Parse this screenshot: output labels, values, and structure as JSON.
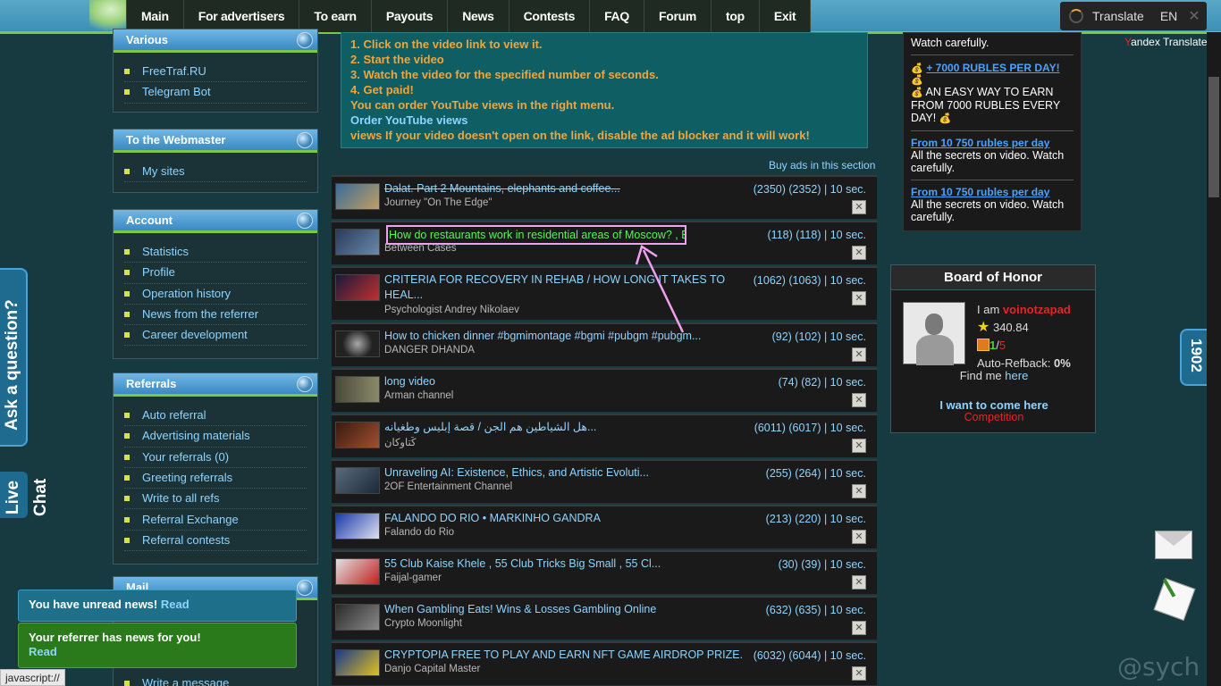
{
  "nav": [
    "Main",
    "For advertisers",
    "To earn",
    "Payouts",
    "News",
    "Contests",
    "FAQ",
    "Forum",
    "top",
    "Exit"
  ],
  "translate": {
    "label": "Translate",
    "lang": "EN",
    "credit_y": "Y",
    "credit_rest": "andex Translate"
  },
  "sidebar": {
    "various": {
      "title": "Various",
      "items": [
        "FreeTraf.RU",
        "Telegram Bot"
      ]
    },
    "webmaster": {
      "title": "To the Webmaster",
      "items": [
        "My sites"
      ]
    },
    "account": {
      "title": "Account",
      "items": [
        "Statistics",
        "Profile",
        "Operation history",
        "News from the referrer",
        "Career development"
      ]
    },
    "referrals": {
      "title": "Referrals",
      "items": [
        "Auto referral",
        "Advertising materials",
        "Your referrals (0)",
        "Greeting referrals",
        "Write to all refs",
        "Referral Exchange",
        "Referral contests"
      ]
    },
    "mail": {
      "title": "Mail",
      "items": [
        "Write a message"
      ]
    }
  },
  "info": {
    "lines": [
      "1. Click on the video link to view it.",
      "2. Start the video",
      "3. Watch the video for the specified number of seconds.",
      "4. Get paid!",
      "You can order YouTube views in the right menu."
    ],
    "order_link": "Order YouTube views",
    "adblock": "views If your video doesn't open on the link, disable the ad blocker and it will work!"
  },
  "buy_ads": "Buy ads in this section",
  "videos": [
    {
      "title": "Dalat. Part 2 Mountains, elephants and coffee...",
      "channel": "Journey \"On The Edge\"",
      "stats": "(2350) (2352) | 10 sec."
    },
    {
      "title": "How do restaurants work in residential areas of Moscow? , Bi...",
      "channel": "Between Cases",
      "stats": "(118) (118) | 10 sec."
    },
    {
      "title": "CRITERIA FOR RECOVERY IN REHAB / HOW LONG IT TAKES TO HEAL...",
      "channel": "Psychologist Andrey Nikolaev",
      "stats": "(1062) (1063) | 10 sec."
    },
    {
      "title": "How to chicken dinner #bgmimontage #bgmi #pubgm #pubgm...",
      "channel": "DANGER DHANDA",
      "stats": "(92) (102) | 10 sec."
    },
    {
      "title": "long video",
      "channel": "Arman channel",
      "stats": "(74) (82) | 10 sec."
    },
    {
      "title": "هل الشياطين هم الجن / قصة إبليس وطغيانه...",
      "channel": "كَتاوكان",
      "stats": "(6011) (6017) | 10 sec."
    },
    {
      "title": "Unraveling AI: Existence, Ethics, and Artistic Evoluti...",
      "channel": "2OF Entertainment Channel",
      "stats": "(255) (264) | 10 sec."
    },
    {
      "title": "FALANDO DO RIO • MARKINHO GANDRA",
      "channel": "Falando do Rio",
      "stats": "(213) (220) | 10 sec."
    },
    {
      "title": "55 Club Kaise Khele , 55 Club Tricks Big Small , 55 Cl...",
      "channel": "Faijal-gamer",
      "stats": "(30) (39) | 10 sec."
    },
    {
      "title": "When Gambling Eats! Wins & Losses Gambling Online",
      "channel": "Crypto Moonlight",
      "stats": "(632) (635) | 10 sec."
    },
    {
      "title": "CRYPTOPIA FREE TO PLAY AND EARN NFT GAME AIRDROP PRIZE...",
      "channel": "Danjo Capital Master",
      "stats": "(6032) (6044) | 10 sec."
    }
  ],
  "right": {
    "watch": "Watch carefully.",
    "link1": "+ 7000 RUBLES PER DAY!",
    "easy": "AN EASY WAY TO EARN FROM 7000 RUBLES EVERY DAY!",
    "link2": "From 10 750 rubles per day",
    "secrets": "All the secrets on video. Watch carefully.",
    "link3": "From 10 750 rubles per day",
    "secrets2": "All the secrets on video. Watch carefully."
  },
  "board": {
    "title": "Board of Honor",
    "i_am": "I am",
    "username": "voinotzapad",
    "rating": "340.84",
    "refs_a": "1",
    "refs_sep": "/",
    "refs_b": "5",
    "refback_label": "Auto-Refback:",
    "refback": "0%",
    "find_me": "Find me",
    "here": "here",
    "come_here": "I want to come here",
    "competition": "Competition"
  },
  "side": {
    "ask": "Ask a question?",
    "live": "Live",
    "chat": "Chat",
    "counter": "1902"
  },
  "notices": {
    "news": "You have unread news!",
    "news_link": "Read",
    "ref": "Your referrer has news for you!",
    "ref_link": "Read"
  },
  "status_bar": "javascript://",
  "watermark": "@sych",
  "colors": {
    "accent_green": "#7ac943",
    "link": "#8fd4ff",
    "highlight_border": "#f0a0f0"
  }
}
